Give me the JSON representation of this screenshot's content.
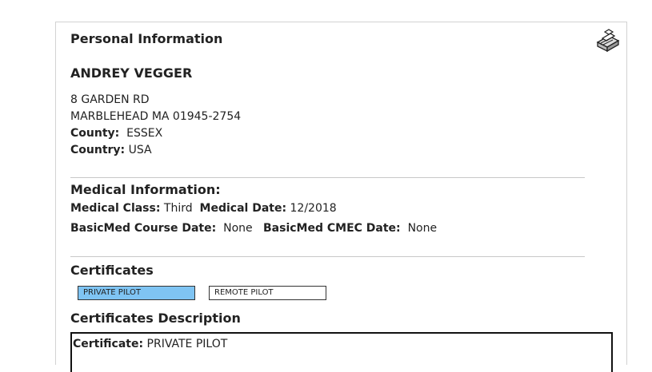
{
  "personal": {
    "heading": "Personal Information",
    "name": "ANDREY VEGGER",
    "address_line1": "8 GARDEN RD",
    "address_line2": "MARBLEHEAD MA 01945-2754",
    "county_label": "County:",
    "county_value": "ESSEX",
    "country_label": "Country:",
    "country_value": "USA"
  },
  "toolbar": {
    "print_icon": "printer-icon"
  },
  "medical": {
    "heading": "Medical Information:",
    "class_label": "Medical Class:",
    "class_value": "Third",
    "date_label": "Medical Date:",
    "date_value": "12/2018",
    "course_label": "BasicMed Course Date:",
    "course_value": "None",
    "cmec_label": "BasicMed CMEC Date:",
    "cmec_value": "None"
  },
  "certificates": {
    "heading": "Certificates",
    "tabs": [
      {
        "label": "PRIVATE PILOT",
        "active": true
      },
      {
        "label": "REMOTE PILOT",
        "active": false
      }
    ],
    "active_color": "#7fc4f3"
  },
  "description": {
    "heading": "Certificates Description",
    "certificate_label": "Certificate:",
    "certificate_value": "PRIVATE PILOT"
  }
}
